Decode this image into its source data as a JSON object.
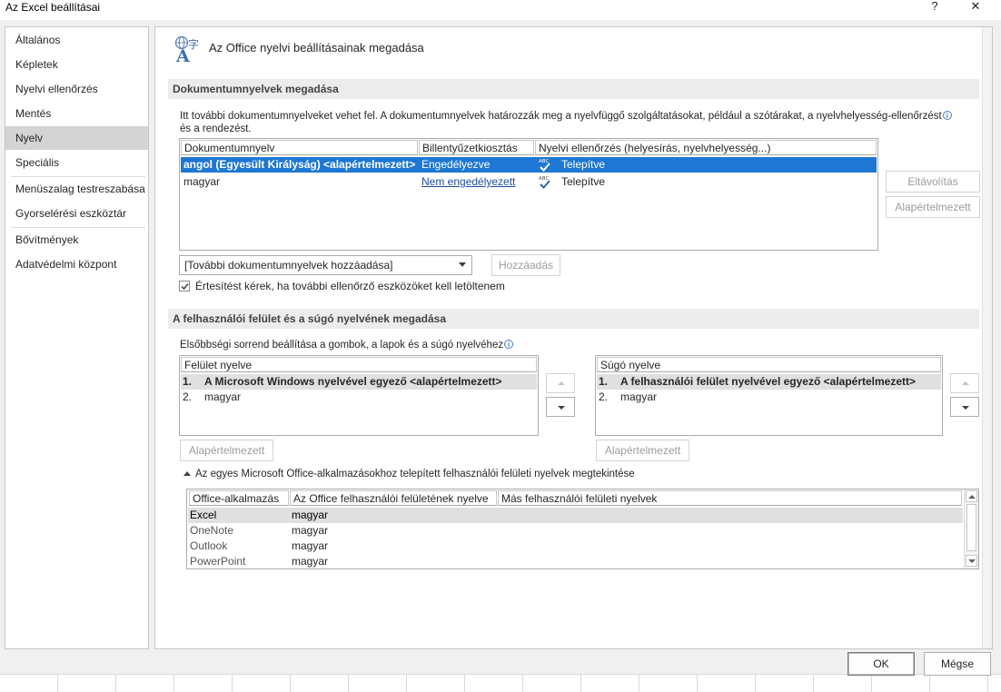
{
  "window": {
    "title": "Az Excel beállításai",
    "help_label": "?",
    "close_label": "✕"
  },
  "nav": {
    "items": [
      {
        "label": "Általános"
      },
      {
        "label": "Képletek"
      },
      {
        "label": "Nyelvi ellenőrzés"
      },
      {
        "label": "Mentés"
      },
      {
        "label": "Nyelv"
      },
      {
        "label": "Speciális"
      },
      {
        "label": "Menüszalag testreszabása"
      },
      {
        "label": "Gyorselérési eszköztár"
      },
      {
        "label": "Bővítmények"
      },
      {
        "label": "Adatvédelmi központ"
      }
    ],
    "selected": "Nyelv"
  },
  "page": {
    "title": "Az Office nyelvi beállításainak megadása"
  },
  "doc_section": {
    "heading": "Dokumentumnyelvek megadása",
    "description_1": "Itt további dokumentumnyelveket vehet fel. A dokumentumnyelvek határozzák meg a nyelvfüggő szolgáltatásokat, például a szótárakat, a nyelvhelyesség-ellenőrzést",
    "description_2": "és a rendezést.",
    "columns": [
      "Dokumentumnyelv",
      "Billentyűzetkiosztás",
      "Nyelvi ellenőrzés (helyesírás, nyelvhelyesség...)"
    ],
    "rows": [
      {
        "language": "angol (Egyesült Királyság) <alapértelmezett>",
        "keyboard": "Engedélyezve",
        "proofing": "Telepítve"
      },
      {
        "language": "magyar",
        "keyboard": "Nem engedélyezett",
        "proofing": "Telepítve"
      }
    ],
    "remove_button": "Eltávolítás",
    "default_button": "Alapértelmezett",
    "add_dropdown_value": "[További dokumentumnyelvek hozzáadása]",
    "add_button": "Hozzáadás",
    "notify_label": "Értesítést kérek, ha további ellenőrző eszközöket kell letöltenem",
    "notify_checked": true
  },
  "ui_section": {
    "heading": "A felhasználói felület és a súgó nyelvének megadása",
    "priority_text": "Elsőbbségi sorrend beállítása a gombok, a lapok és a súgó nyelvéhez",
    "display_list": {
      "header": "Felület nyelve",
      "items": [
        {
          "num": "1.",
          "label": "A Microsoft Windows nyelvével egyező <alapértelmezett>"
        },
        {
          "num": "2.",
          "label": "magyar"
        }
      ],
      "default_button": "Alapértelmezett"
    },
    "help_list": {
      "header": "Súgó nyelve",
      "items": [
        {
          "num": "1.",
          "label": "A felhasználói felület nyelvével egyező <alapértelmezett>"
        },
        {
          "num": "2.",
          "label": "magyar"
        }
      ],
      "default_button": "Alapértelmezett"
    },
    "expander_label": "Az egyes Microsoft Office-alkalmazásokhoz telepített felhasználói felületi nyelvek megtekintése",
    "apps_table": {
      "columns": [
        "Office-alkalmazás",
        "Az Office felhasználói felületének nyelve",
        "Más felhasználói felületi nyelvek"
      ],
      "rows": [
        {
          "app": "Excel",
          "ui": "magyar",
          "other": ""
        },
        {
          "app": "OneNote",
          "ui": "magyar",
          "other": ""
        },
        {
          "app": "Outlook",
          "ui": "magyar",
          "other": ""
        },
        {
          "app": "PowerPoint",
          "ui": "magyar",
          "other": ""
        }
      ]
    }
  },
  "footer": {
    "ok_label": "OK",
    "cancel_label": "Mégse"
  },
  "colors": {
    "selection": "#1e78d3",
    "link": "#1f4e9c",
    "check": "#2b6cb4"
  }
}
